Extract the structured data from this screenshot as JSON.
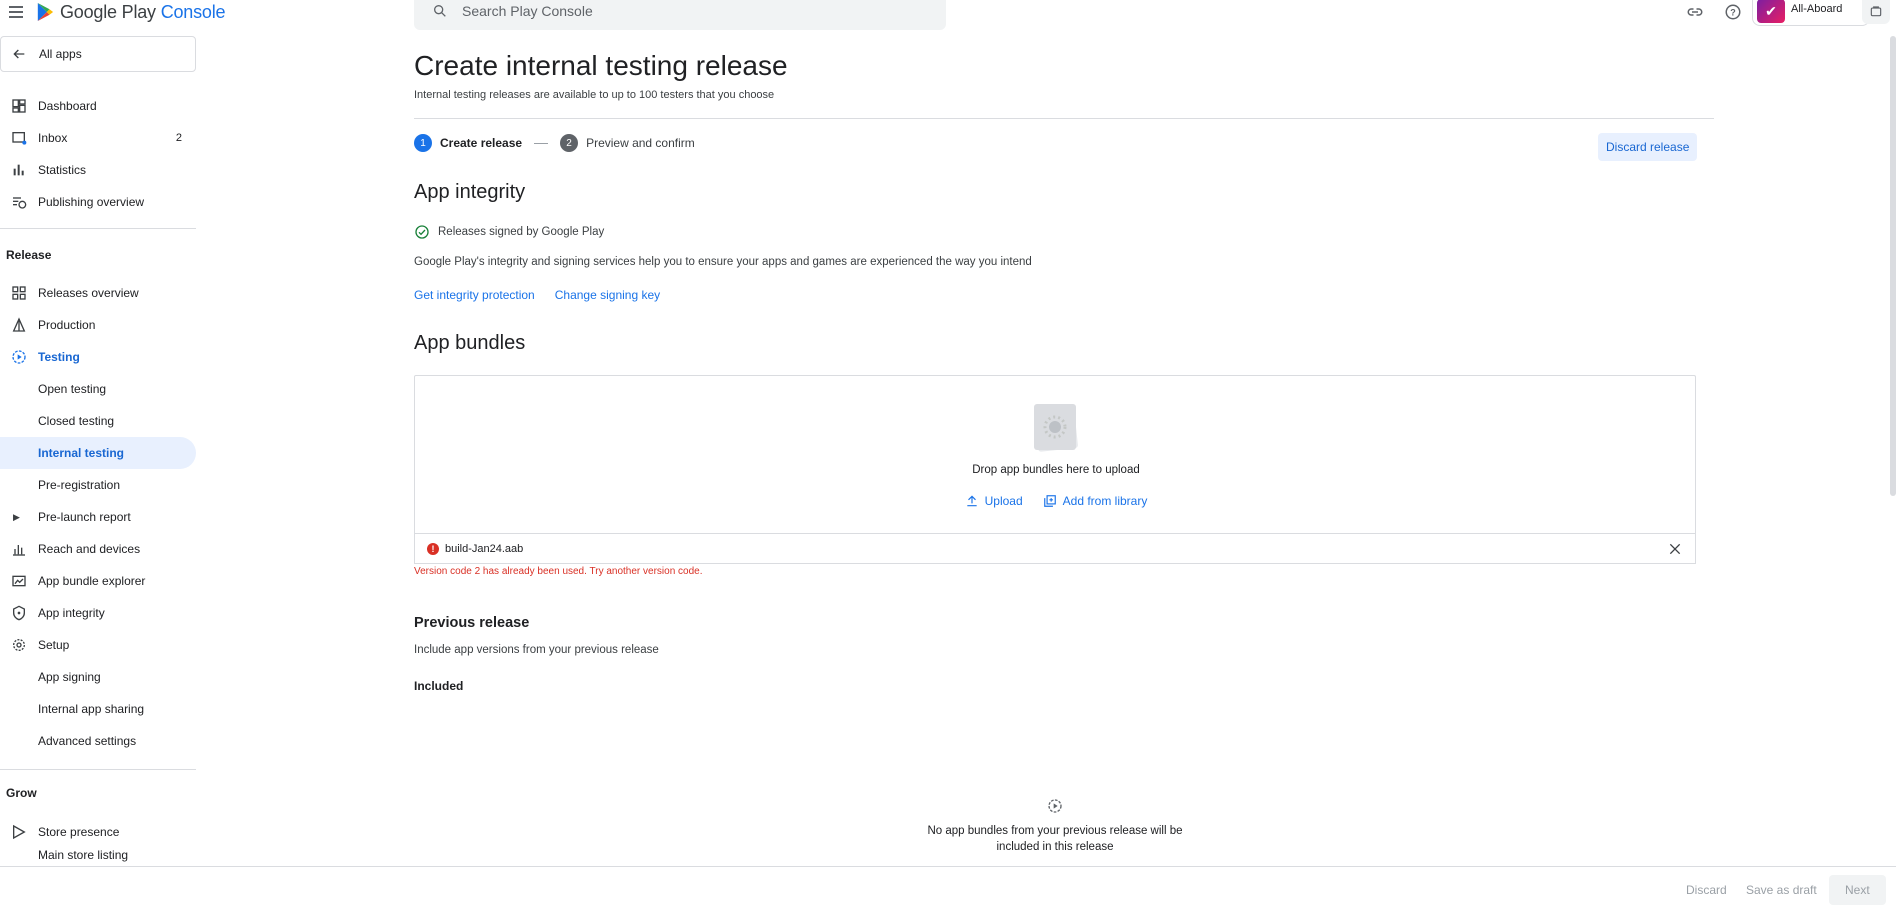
{
  "header": {
    "logo_text": "Google Play",
    "logo_accent": "Console",
    "search_placeholder": "Search Play Console",
    "account_name": "All-Aboard"
  },
  "sidebar": {
    "all_apps": "All apps",
    "top_items": [
      {
        "label": "Dashboard",
        "icon": "dashboard-icon"
      },
      {
        "label": "Inbox",
        "icon": "inbox-icon",
        "count": "2"
      },
      {
        "label": "Statistics",
        "icon": "bar-chart-icon"
      },
      {
        "label": "Publishing overview",
        "icon": "publishing-icon"
      }
    ],
    "release_section": "Release",
    "release_items": [
      {
        "label": "Releases overview",
        "icon": "releases-icon"
      },
      {
        "label": "Production",
        "icon": "production-icon"
      },
      {
        "label": "Testing",
        "icon": "testing-icon"
      },
      {
        "label": "Open testing"
      },
      {
        "label": "Closed testing"
      },
      {
        "label": "Internal testing"
      },
      {
        "label": "Pre-registration"
      },
      {
        "label": "Pre-launch report"
      },
      {
        "label": "Reach and devices",
        "icon": "reach-icon"
      },
      {
        "label": "App bundle explorer",
        "icon": "bundle-explorer-icon"
      },
      {
        "label": "App integrity",
        "icon": "shield-icon"
      },
      {
        "label": "Setup",
        "icon": "gear-icon"
      },
      {
        "label": "App signing"
      },
      {
        "label": "Internal app sharing"
      },
      {
        "label": "Advanced settings"
      }
    ],
    "grow_section": "Grow",
    "grow_items": [
      {
        "label": "Store presence",
        "icon": "store-presence-icon"
      },
      {
        "label": "Main store listing"
      }
    ]
  },
  "main": {
    "title": "Create internal testing release",
    "subtitle": "Internal testing releases are available to up to 100 testers that you choose",
    "steps": [
      {
        "num": "1",
        "label": "Create release"
      },
      {
        "num": "2",
        "label": "Preview and confirm"
      }
    ],
    "discard_release": "Discard release",
    "integrity": {
      "heading": "App integrity",
      "status": "Releases signed by Google Play",
      "description": "Google Play's integrity and signing services help you to ensure your apps and games are experienced the way you intend",
      "link_protection": "Get integrity protection",
      "link_signing_key": "Change signing key"
    },
    "bundles": {
      "heading": "App bundles",
      "drop_text": "Drop app bundles here to upload",
      "upload": "Upload",
      "add_from_library": "Add from library",
      "file_name": "build-Jan24.aab",
      "error": "Version code 2 has already been used. Try another version code."
    },
    "previous": {
      "heading": "Previous release",
      "description": "Include app versions from your previous release",
      "included": "Included",
      "empty_line1": "No app bundles from your previous release will be",
      "empty_line2": "included in this release"
    }
  },
  "footer": {
    "discard": "Discard",
    "save_draft": "Save as draft",
    "next": "Next"
  },
  "colors": {
    "accent": "#1a73e8",
    "active_bg": "#e8f0fe",
    "error": "#d93025",
    "success": "#188038"
  }
}
